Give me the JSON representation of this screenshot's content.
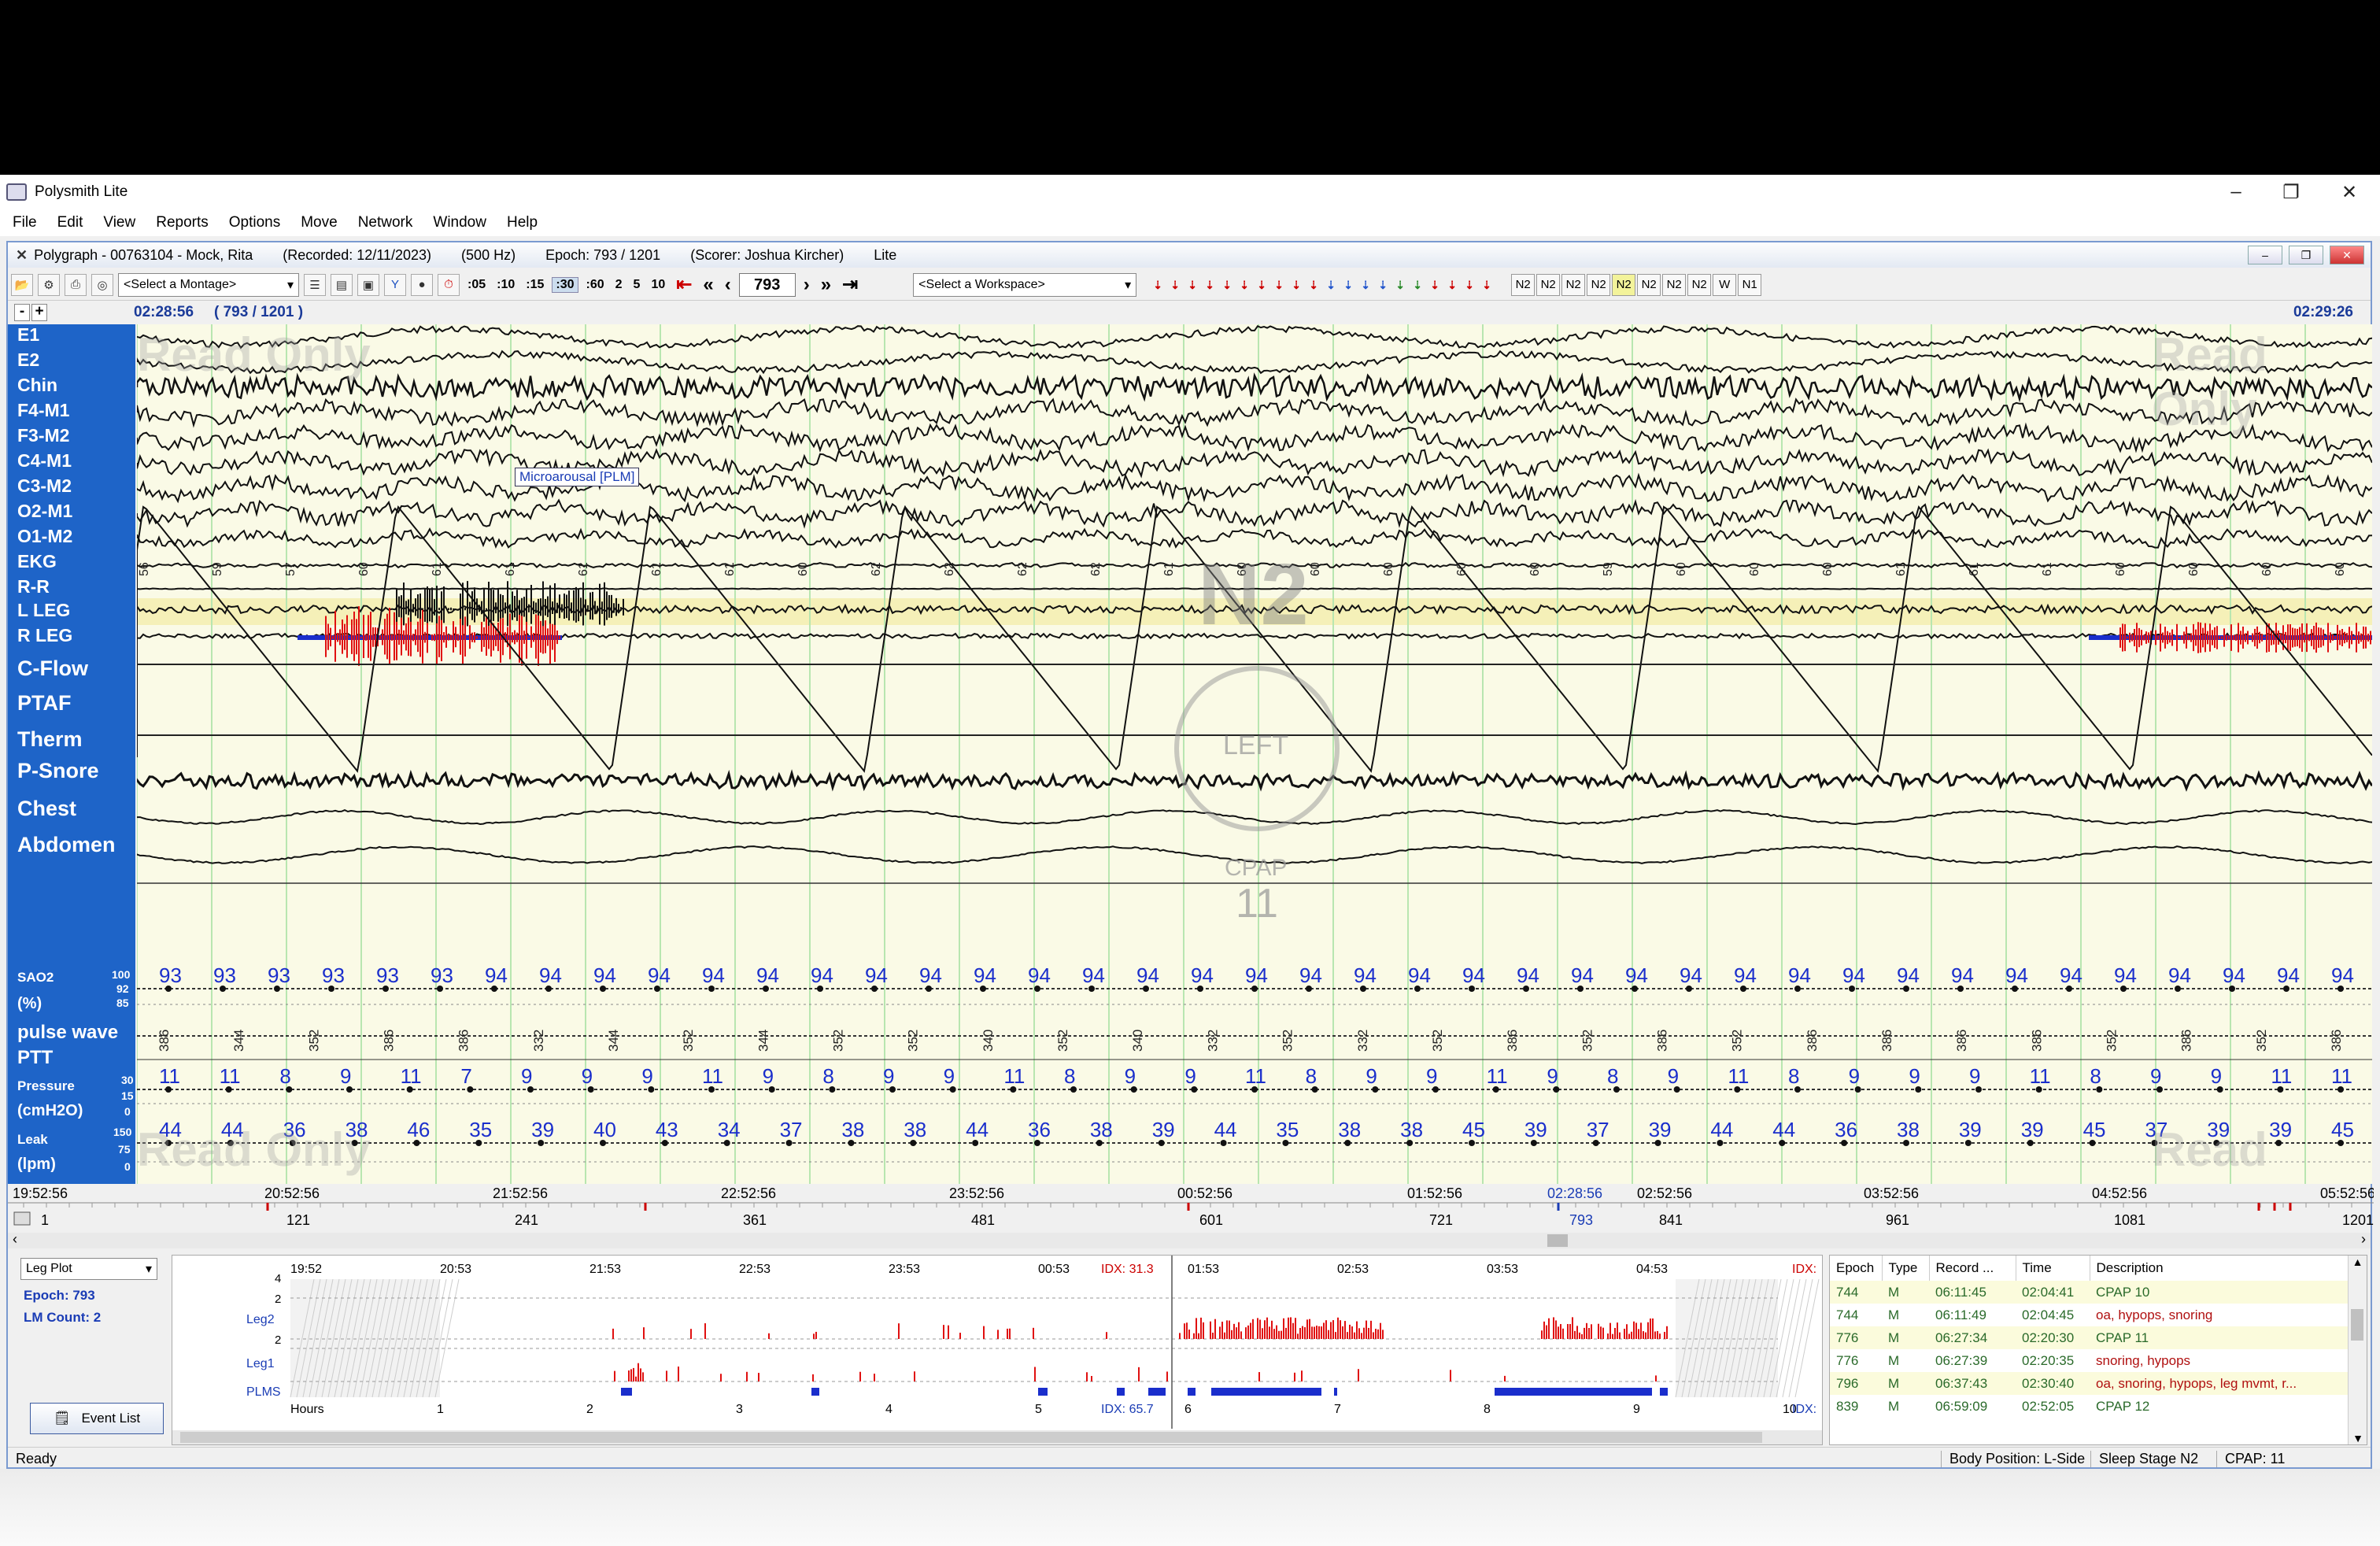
{
  "app": {
    "title": "Polysmith Lite"
  },
  "menu": [
    "File",
    "Edit",
    "View",
    "Reports",
    "Options",
    "Move",
    "Network",
    "Window",
    "Help"
  ],
  "child": {
    "title": "Polygraph - 00763104 - Mock, Rita",
    "recorded": "(Recorded: 12/11/2023)",
    "rate": "(500 Hz)",
    "epoch": "Epoch: 793 / 1201",
    "scorer": "(Scorer: Joshua Kircher)",
    "mode": "Lite"
  },
  "toolbar": {
    "montage": "<Select a Montage>",
    "workspace": "<Select a Workspace>",
    "epoch_lengths": [
      ":05",
      ":10",
      ":15",
      ":30",
      ":60",
      "2",
      "5",
      "10"
    ],
    "epoch_value": "793",
    "stages": [
      "N2",
      "N2",
      "N2",
      "N2",
      "N2",
      "N2",
      "N2",
      "N2",
      "W",
      "N1"
    ]
  },
  "view": {
    "start_time": "02:28:56",
    "epoch_pos": "( 793 / 1201 )",
    "end_time": "02:29:26",
    "watermark": "Read Only",
    "stage_watermark": "N2",
    "position_watermark": "LEFT",
    "cpap_label": "CPAP",
    "cpap_value": "11",
    "annotation": "Microarousal [PLM]"
  },
  "channels": [
    "E1",
    "E2",
    "Chin",
    "F4-M1",
    "F3-M2",
    "C4-M1",
    "C3-M2",
    "O2-M1",
    "O1-M2",
    "EKG",
    "R-R",
    "L LEG",
    "R LEG",
    "C-Flow",
    "PTAF",
    "Therm",
    "P-Snore",
    "Chest",
    "Abdomen"
  ],
  "numeric_channels": {
    "sao2": {
      "label": "SAO2",
      "unit": "(%)",
      "scale": [
        "100",
        "92",
        "85"
      ],
      "values": [
        "93",
        "93",
        "93",
        "93",
        "93",
        "93",
        "94",
        "94",
        "94",
        "94",
        "94",
        "94",
        "94",
        "94",
        "94",
        "94",
        "94",
        "94",
        "94",
        "94",
        "94",
        "94",
        "94",
        "94",
        "94",
        "94",
        "94",
        "94",
        "94",
        "94",
        "94",
        "94",
        "94",
        "94",
        "94",
        "94",
        "94",
        "94",
        "94",
        "94",
        "94"
      ]
    },
    "pulse": {
      "label": "pulse wave",
      "label2": "PTT",
      "values": [
        "386",
        "344",
        "352",
        "386",
        "386",
        "332",
        "344",
        "352",
        "344",
        "352",
        "352",
        "340",
        "352",
        "340",
        "332",
        "352",
        "332",
        "352",
        "386",
        "352",
        "386",
        "352",
        "386",
        "386",
        "386",
        "386",
        "352",
        "386",
        "352",
        "386"
      ]
    },
    "pressure": {
      "label": "Pressure",
      "unit": "(cmH2O)",
      "scale": [
        "30",
        "15",
        "0"
      ],
      "values": [
        "11",
        "11",
        "8",
        "9",
        "11",
        "7",
        "9",
        "9",
        "9",
        "11",
        "9",
        "8",
        "9",
        "9",
        "11",
        "8",
        "9",
        "9",
        "11",
        "8",
        "9",
        "9",
        "11",
        "9",
        "8",
        "9",
        "11",
        "8",
        "9",
        "9",
        "9",
        "11",
        "8",
        "9",
        "9",
        "11",
        "11"
      ]
    },
    "leak": {
      "label": "Leak",
      "unit": "(lpm)",
      "scale": [
        "150",
        "75",
        "0"
      ],
      "values": [
        "44",
        "44",
        "36",
        "38",
        "46",
        "35",
        "39",
        "40",
        "43",
        "34",
        "37",
        "38",
        "38",
        "44",
        "36",
        "38",
        "39",
        "44",
        "35",
        "38",
        "38",
        "45",
        "39",
        "37",
        "39",
        "44",
        "44",
        "36",
        "38",
        "39",
        "39",
        "45",
        "37",
        "39",
        "39",
        "45"
      ]
    }
  },
  "ekg_values": [
    "56",
    "59",
    "57",
    "60",
    "61",
    "61",
    "61",
    "61",
    "61",
    "60",
    "62",
    "62",
    "62",
    "62",
    "61",
    "60",
    "60",
    "60",
    "60",
    "60",
    "59",
    "60",
    "60",
    "60",
    "61",
    "61",
    "61",
    "60",
    "60",
    "60",
    "60"
  ],
  "timeline": {
    "times": [
      "19:52:56",
      "20:52:56",
      "21:52:56",
      "22:52:56",
      "23:52:56",
      "00:52:56",
      "01:52:56",
      "02:28:56",
      "02:52:56",
      "03:52:56",
      "04:52:56",
      "05:52:56"
    ],
    "epochs": [
      "1",
      "121",
      "241",
      "361",
      "481",
      "601",
      "721",
      "793",
      "841",
      "961",
      "1081",
      "1201"
    ]
  },
  "legpanel": {
    "plot_select": "Leg Plot",
    "epoch": "Epoch: 793",
    "lm_count": "LM Count: 2",
    "event_list_btn": "Event List",
    "times": [
      "19:52",
      "20:53",
      "21:53",
      "22:53",
      "23:53",
      "00:53",
      "01:53",
      "02:53",
      "03:53",
      "04:53"
    ],
    "hours": [
      "Hours",
      "1",
      "2",
      "3",
      "4",
      "5",
      "6",
      "7",
      "8",
      "9",
      "10"
    ],
    "rows": [
      "Leg2",
      "Leg1",
      "PLMS"
    ],
    "scale": [
      "4",
      "2",
      "2"
    ],
    "idx_top": "IDX: 31.3",
    "idx_bottom": "IDX: 65.7",
    "idx_right": "IDX:"
  },
  "events": {
    "headers": [
      "Epoch",
      "Type",
      "Record ...",
      "Time",
      "Description"
    ],
    "rows": [
      [
        "744",
        "M",
        "06:11:45",
        "02:04:41",
        "CPAP 10"
      ],
      [
        "744",
        "M",
        "06:11:49",
        "02:04:45",
        "oa, hypops, snoring"
      ],
      [
        "776",
        "M",
        "06:27:34",
        "02:20:30",
        "CPAP 11"
      ],
      [
        "776",
        "M",
        "06:27:39",
        "02:20:35",
        "snoring, hypops"
      ],
      [
        "796",
        "M",
        "06:37:43",
        "02:30:40",
        "oa, snoring, hypops, leg mvmt, r..."
      ],
      [
        "839",
        "M",
        "06:59:09",
        "02:52:05",
        "CPAP 12"
      ]
    ]
  },
  "status": {
    "ready": "Ready",
    "position": "Body Position: L-Side",
    "stage": "Sleep Stage N2",
    "cpap": "CPAP: 11"
  },
  "colors": {
    "label_bg": "#1e64c8",
    "signal_bg": "#fafae6",
    "value_blue": "#1a2ecc",
    "leg_red": "#e01010"
  }
}
